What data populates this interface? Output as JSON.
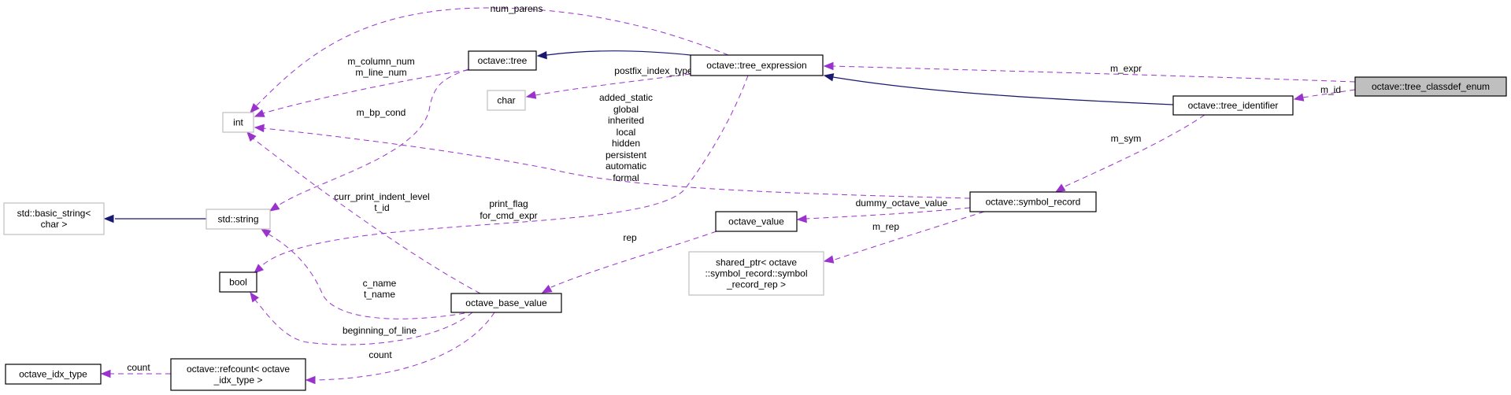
{
  "colors": {
    "usage_edge": "#9a32cd",
    "inheritance_edge": "#191970",
    "focus_node_fill": "#bfbfbf",
    "undocumented_border": "#bfbfbf",
    "documented_border": "#000000"
  },
  "nodes": [
    {
      "id": "tree_classdef_enum",
      "lines": [
        "octave::tree_classdef_enum"
      ],
      "style": "focus"
    },
    {
      "id": "tree_expression",
      "lines": [
        "octave::tree_expression"
      ],
      "style": "solid"
    },
    {
      "id": "tree_identifier",
      "lines": [
        "octave::tree_identifier"
      ],
      "style": "solid"
    },
    {
      "id": "tree",
      "lines": [
        "octave::tree"
      ],
      "style": "solid"
    },
    {
      "id": "int",
      "lines": [
        "int"
      ],
      "style": "grey"
    },
    {
      "id": "char",
      "lines": [
        "char"
      ],
      "style": "grey"
    },
    {
      "id": "std_string",
      "lines": [
        "std::string"
      ],
      "style": "grey"
    },
    {
      "id": "basic_string",
      "lines": [
        "std::basic_string<",
        "char >"
      ],
      "style": "grey"
    },
    {
      "id": "bool",
      "lines": [
        "bool"
      ],
      "style": "solid"
    },
    {
      "id": "symbol_record",
      "lines": [
        "octave::symbol_record"
      ],
      "style": "solid"
    },
    {
      "id": "octave_value",
      "lines": [
        "octave_value"
      ],
      "style": "solid"
    },
    {
      "id": "shared_ptr",
      "lines": [
        "shared_ptr< octave",
        "::symbol_record::symbol",
        "_record_rep >"
      ],
      "style": "grey"
    },
    {
      "id": "octave_base_value",
      "lines": [
        "octave_base_value"
      ],
      "style": "solid"
    },
    {
      "id": "refcount",
      "lines": [
        "octave::refcount< octave",
        "_idx_type >"
      ],
      "style": "solid"
    },
    {
      "id": "octave_idx_type",
      "lines": [
        "octave_idx_type"
      ],
      "style": "solid"
    }
  ],
  "edges": [
    {
      "from": "tree_expression",
      "to": "tree_classdef_enum",
      "kind": "usage",
      "labels": [
        "m_expr"
      ]
    },
    {
      "from": "tree_identifier",
      "to": "tree_classdef_enum",
      "kind": "usage",
      "labels": [
        "m_id"
      ]
    },
    {
      "from": "tree_expression",
      "to": "tree_identifier",
      "kind": "inheritance",
      "labels": []
    },
    {
      "from": "tree",
      "to": "tree_expression",
      "kind": "inheritance",
      "labels": []
    },
    {
      "from": "int",
      "to": "tree_expression",
      "kind": "usage",
      "labels": [
        "num_parens"
      ]
    },
    {
      "from": "char",
      "to": "tree_expression",
      "kind": "usage",
      "labels": [
        "postfix_index_type"
      ]
    },
    {
      "from": "bool",
      "to": "tree_expression",
      "kind": "usage",
      "labels": [
        "print_flag",
        "for_cmd_expr"
      ]
    },
    {
      "from": "int",
      "to": "tree",
      "kind": "usage",
      "labels": [
        "m_column_num",
        "m_line_num"
      ]
    },
    {
      "from": "std_string",
      "to": "tree",
      "kind": "usage",
      "labels": [
        "m_bp_cond"
      ]
    },
    {
      "from": "symbol_record",
      "to": "tree_identifier",
      "kind": "usage",
      "labels": [
        "m_sym"
      ]
    },
    {
      "from": "int",
      "to": "symbol_record",
      "kind": "usage",
      "labels": [
        "added_static",
        "global",
        "inherited",
        "local",
        "hidden",
        "persistent",
        "automatic",
        "formal"
      ]
    },
    {
      "from": "octave_value",
      "to": "symbol_record",
      "kind": "usage",
      "labels": [
        "dummy_octave_value"
      ]
    },
    {
      "from": "shared_ptr",
      "to": "symbol_record",
      "kind": "usage",
      "labels": [
        "m_rep"
      ]
    },
    {
      "from": "octave_base_value",
      "to": "octave_value",
      "kind": "usage",
      "labels": [
        "rep"
      ]
    },
    {
      "from": "int",
      "to": "octave_base_value",
      "kind": "usage",
      "labels": [
        "curr_print_indent_level",
        "t_id"
      ]
    },
    {
      "from": "std_string",
      "to": "octave_base_value",
      "kind": "usage",
      "labels": [
        "c_name",
        "t_name"
      ]
    },
    {
      "from": "bool",
      "to": "octave_base_value",
      "kind": "usage",
      "labels": [
        "beginning_of_line"
      ]
    },
    {
      "from": "refcount",
      "to": "octave_base_value",
      "kind": "usage",
      "labels": [
        "count"
      ]
    },
    {
      "from": "octave_idx_type",
      "to": "refcount",
      "kind": "usage",
      "labels": [
        "count"
      ]
    },
    {
      "from": "basic_string",
      "to": "std_string",
      "kind": "inheritance",
      "labels": []
    }
  ]
}
